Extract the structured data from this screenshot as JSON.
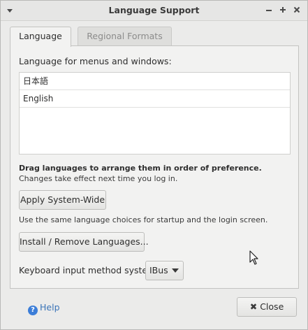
{
  "window": {
    "title": "Language Support"
  },
  "tabs": [
    {
      "label": "Language",
      "active": true
    },
    {
      "label": "Regional Formats",
      "active": false
    }
  ],
  "language_tab": {
    "menus_label": "Language for menus and windows:",
    "languages": [
      "日本語",
      "English"
    ],
    "drag_hint": "Drag languages to arrange them in order of preference.",
    "changes_hint": "Changes take effect next time you log in.",
    "apply_button": "Apply System-Wide",
    "same_choices_hint": "Use the same language choices for startup and the login screen.",
    "install_button": "Install / Remove Languages...",
    "keyboard_label": "Keyboard input method system:",
    "keyboard_value": "IBus"
  },
  "footer": {
    "help_label": "Help",
    "close_label": "Close"
  }
}
